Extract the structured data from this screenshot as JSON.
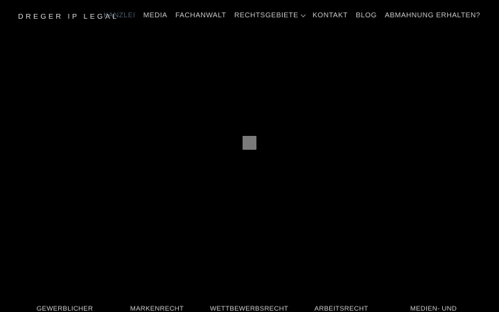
{
  "header": {
    "logo": "DREGER IP LEGAL",
    "nav": [
      {
        "label": "KANZLEI",
        "active": true
      },
      {
        "label": "MEDIA"
      },
      {
        "label": "FACHANWALT"
      },
      {
        "label": "RECHTSGEBIETE",
        "dropdown": true
      },
      {
        "label": "KONTAKT"
      },
      {
        "label": "BLOG"
      },
      {
        "label": "ABMAHNUNG ERHALTEN?"
      }
    ]
  },
  "colors": {
    "background": "#000000",
    "nav_active": "#4f5a6a",
    "nav_text": "#c9c9c9",
    "loader": "#7a7a7a"
  },
  "categories": [
    "GEWERBLICHER",
    "MARKENRECHT",
    "WETTBEWERBSRECHT",
    "ARBEITSRECHT",
    "MEDIEN- UND"
  ]
}
